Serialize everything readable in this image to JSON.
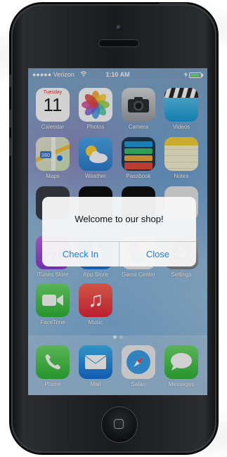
{
  "status": {
    "carrier": "●●●●● Verizon",
    "time": "1:10 AM"
  },
  "apps": [
    {
      "label": "Calendar",
      "icon": "calendar-icon",
      "day": "Tuesday",
      "date": "11"
    },
    {
      "label": "Photos",
      "icon": "photos-icon"
    },
    {
      "label": "Camera",
      "icon": "camera-icon"
    },
    {
      "label": "Videos",
      "icon": "videos-icon"
    },
    {
      "label": "Maps",
      "icon": "maps-icon"
    },
    {
      "label": "Weather",
      "icon": "weather-icon"
    },
    {
      "label": "Passbook",
      "icon": "passbook-icon"
    },
    {
      "label": "Notes",
      "icon": "notes-icon"
    },
    {
      "label": "iTunes Store",
      "icon": "itunes-store-icon"
    },
    {
      "label": "App Store",
      "icon": "app-store-icon"
    },
    {
      "label": "Game Center",
      "icon": "game-center-icon"
    },
    {
      "label": "Settings",
      "icon": "settings-icon"
    },
    {
      "label": "FaceTime",
      "icon": "facetime-icon"
    },
    {
      "label": "Music",
      "icon": "music-icon"
    }
  ],
  "dock": [
    {
      "label": "Phone",
      "icon": "phone-icon"
    },
    {
      "label": "Mail",
      "icon": "mail-icon"
    },
    {
      "label": "Safari",
      "icon": "safari-icon"
    },
    {
      "label": "Messages",
      "icon": "messages-icon"
    }
  ],
  "alert": {
    "message": "Welcome to our shop!",
    "check_in_label": "Check In",
    "close_label": "Close"
  },
  "colors": {
    "alert_button": "#1a7cf3"
  }
}
